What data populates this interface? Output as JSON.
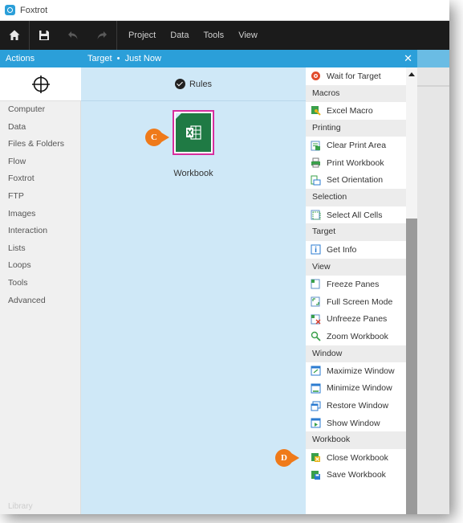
{
  "app": {
    "title": "Foxtrot"
  },
  "toolbar": {
    "menus": [
      "Project",
      "Data",
      "Tools",
      "View"
    ]
  },
  "actions_header": "Actions",
  "target_header": {
    "text": "Target  •  Just Now",
    "close": "✕"
  },
  "sidebar": {
    "items": [
      "Computer",
      "Data",
      "Files & Folders",
      "Flow",
      "Foxtrot",
      "FTP",
      "Images",
      "Interaction",
      "Lists",
      "Loops",
      "Tools",
      "Advanced"
    ],
    "library": "Library"
  },
  "center": {
    "rules_label": "Rules",
    "workbook_label": "Workbook",
    "callout_c": "C"
  },
  "panel": {
    "top_item": "Wait for Target",
    "groups": [
      {
        "category": "Macros",
        "items": [
          {
            "label": "Excel Macro",
            "icon": "macro-icon"
          }
        ]
      },
      {
        "category": "Printing",
        "items": [
          {
            "label": "Clear Print Area",
            "icon": "clear-print-area-icon"
          },
          {
            "label": "Print Workbook",
            "icon": "print-icon"
          },
          {
            "label": "Set Orientation",
            "icon": "orientation-icon"
          }
        ]
      },
      {
        "category": "Selection",
        "items": [
          {
            "label": "Select All Cells",
            "icon": "select-all-icon"
          }
        ]
      },
      {
        "category": "Target",
        "items": [
          {
            "label": "Get Info",
            "icon": "info-icon"
          }
        ]
      },
      {
        "category": "View",
        "items": [
          {
            "label": "Freeze Panes",
            "icon": "freeze-panes-icon"
          },
          {
            "label": "Full Screen Mode",
            "icon": "full-screen-icon"
          },
          {
            "label": "Unfreeze Panes",
            "icon": "unfreeze-panes-icon"
          },
          {
            "label": "Zoom Workbook",
            "icon": "zoom-icon"
          }
        ]
      },
      {
        "category": "Window",
        "items": [
          {
            "label": "Maximize Window",
            "icon": "maximize-window-icon"
          },
          {
            "label": "Minimize Window",
            "icon": "minimize-window-icon"
          },
          {
            "label": "Restore Window",
            "icon": "restore-window-icon"
          },
          {
            "label": "Show Window",
            "icon": "show-window-icon"
          }
        ]
      },
      {
        "category": "Workbook",
        "items": [
          {
            "label": "Close Workbook",
            "icon": "close-workbook-icon"
          },
          {
            "label": "Save Workbook",
            "icon": "save-workbook-icon"
          }
        ]
      }
    ],
    "callout_d": "D"
  },
  "colors": {
    "accent": "#2b9fd9",
    "toolbar": "#1b1b1b",
    "center_bg": "#cfe8f7",
    "callout": "#ef7a1a",
    "selection_border": "#d62e9e",
    "excel_green": "#1f7a44"
  }
}
